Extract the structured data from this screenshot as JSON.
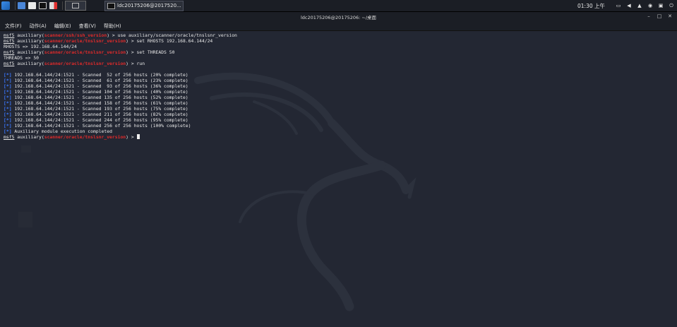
{
  "taskbar": {
    "window_task_label": "ldc20175206@2017520...",
    "clock": "01:30 上午"
  },
  "window": {
    "title": "ldc20175206@20175206: ~/桌面"
  },
  "menu": {
    "items": [
      "文件(F)",
      "动作(A)",
      "编辑(E)",
      "查看(V)",
      "帮助(H)"
    ]
  },
  "terminal": {
    "prompt_label": "msf5",
    "lines": [
      {
        "type": "prompt",
        "module": "scanner/ssh/ssh_version",
        "command": "use auxiliary/scanner/oracle/tnslsnr_version"
      },
      {
        "type": "prompt",
        "module": "scanner/oracle/tnslsnr_version",
        "command": "set RHOSTS 192.168.64.144/24"
      },
      {
        "type": "text",
        "text": "RHOSTS => 192.168.64.144/24"
      },
      {
        "type": "prompt",
        "module": "scanner/oracle/tnslsnr_version",
        "command": "set THREADS 50"
      },
      {
        "type": "text",
        "text": "THREADS => 50"
      },
      {
        "type": "prompt",
        "module": "scanner/oracle/tnslsnr_version",
        "command": "run"
      },
      {
        "type": "blank"
      },
      {
        "type": "status",
        "text": "192.168.64.144/24:1521 - Scanned  52 of 256 hosts (20% complete)"
      },
      {
        "type": "status",
        "text": "192.168.64.144/24:1521 - Scanned  61 of 256 hosts (23% complete)"
      },
      {
        "type": "status",
        "text": "192.168.64.144/24:1521 - Scanned  93 of 256 hosts (36% complete)"
      },
      {
        "type": "status",
        "text": "192.168.64.144/24:1521 - Scanned 104 of 256 hosts (40% complete)"
      },
      {
        "type": "status",
        "text": "192.168.64.144/24:1521 - Scanned 135 of 256 hosts (52% complete)"
      },
      {
        "type": "status",
        "text": "192.168.64.144/24:1521 - Scanned 158 of 256 hosts (61% complete)"
      },
      {
        "type": "status",
        "text": "192.168.64.144/24:1521 - Scanned 193 of 256 hosts (75% complete)"
      },
      {
        "type": "status",
        "text": "192.168.64.144/24:1521 - Scanned 211 of 256 hosts (82% complete)"
      },
      {
        "type": "status",
        "text": "192.168.64.144/24:1521 - Scanned 244 of 256 hosts (95% complete)"
      },
      {
        "type": "status",
        "text": "192.168.64.144/24:1521 - Scanned 256 of 256 hosts (100% complete)"
      },
      {
        "type": "status",
        "text": "Auxiliary module execution completed"
      },
      {
        "type": "prompt",
        "module": "scanner/oracle/tnslsnr_version",
        "command": "",
        "cursor": true
      }
    ],
    "status_marker": "[*]"
  },
  "colors": {
    "terminal_bg": "#232733",
    "module_red": "#e02a2a",
    "status_blue": "#3b78ff"
  }
}
